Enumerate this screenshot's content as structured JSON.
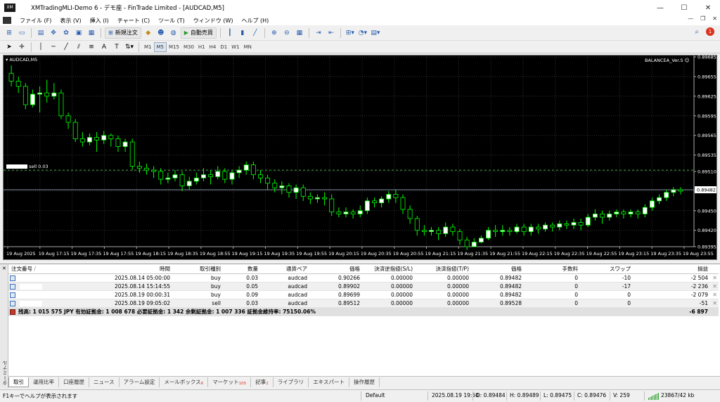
{
  "window": {
    "title": "XMTradingMLI-Demo 6 - デモ座 - FinTrade Limited - [AUDCAD,M5]",
    "app_logo": "XM",
    "minimize_glyph": "—",
    "maximize_glyph": "☐",
    "close_glyph": "✕"
  },
  "menu": {
    "items": [
      "ファイル (F)",
      "表示 (V)",
      "挿入 (I)",
      "チャート (C)",
      "ツール (T)",
      "ウィンドウ (W)",
      "ヘルプ (H)"
    ],
    "mdi_minimize": "—",
    "mdi_restore": "❐",
    "mdi_close": "✕"
  },
  "toolbar": {
    "new_order_label": "新規注文",
    "autotrade_label": "自動売買",
    "notification_count": "1",
    "timeframes": [
      "M1",
      "M5",
      "M15",
      "M30",
      "H1",
      "H4",
      "D1",
      "W1",
      "MN"
    ],
    "active_timeframe": "M5"
  },
  "chart": {
    "symbol_label": "AUDCAD,M5",
    "indicator_label": "BALANCEA_Ver.S",
    "order_line_label": "sell 0.03",
    "current_price": "0.89482",
    "colors": {
      "background": "#000000",
      "grid": "#303030",
      "bull_candle": "#ffffff",
      "bear_candle": "#000000",
      "wick": "#00ff00",
      "order_line": "#4aa84a",
      "bid_line": "#8090a0"
    }
  },
  "chart_data": {
    "type": "candlestick",
    "symbol": "AUDCAD",
    "timeframe": "M5",
    "y_ticks": [
      "0.89685",
      "0.89655",
      "0.89625",
      "0.89595",
      "0.89565",
      "0.89535",
      "0.89510",
      "0.89480",
      "0.89450",
      "0.89420",
      "0.89395"
    ],
    "ylim": [
      0.89395,
      0.89685
    ],
    "x_ticks": [
      "19 Aug 2025",
      "19 Aug 17:15",
      "19 Aug 17:35",
      "19 Aug 17:55",
      "19 Aug 18:15",
      "19 Aug 18:35",
      "19 Aug 18:55",
      "19 Aug 19:15",
      "19 Aug 19:35",
      "19 Aug 19:55",
      "19 Aug 20:15",
      "19 Aug 20:35",
      "19 Aug 20:55",
      "19 Aug 21:15",
      "19 Aug 21:35",
      "19 Aug 21:55",
      "19 Aug 22:15",
      "19 Aug 22:35",
      "19 Aug 22:55",
      "19 Aug 23:15",
      "19 Aug 23:35",
      "19 Aug 23:55"
    ],
    "order_level": 0.89512,
    "bid_level": 0.89482,
    "candles": [
      [
        0.8966,
        0.89648,
        0.89672,
        0.8964
      ],
      [
        0.89648,
        0.8964,
        0.89655,
        0.8963
      ],
      [
        0.8964,
        0.89612,
        0.89645,
        0.89605
      ],
      [
        0.89612,
        0.89628,
        0.89635,
        0.89608
      ],
      [
        0.89628,
        0.8963,
        0.8964,
        0.896
      ],
      [
        0.8963,
        0.89625,
        0.8965,
        0.89615
      ],
      [
        0.89625,
        0.8963,
        0.89645,
        0.8962
      ],
      [
        0.8963,
        0.89595,
        0.89635,
        0.8959
      ],
      [
        0.89595,
        0.89585,
        0.896,
        0.89575
      ],
      [
        0.89585,
        0.8956,
        0.8959,
        0.89555
      ],
      [
        0.8956,
        0.89555,
        0.8957,
        0.89548
      ],
      [
        0.89555,
        0.89562,
        0.89568,
        0.8955
      ],
      [
        0.89562,
        0.89558,
        0.8957,
        0.8954
      ],
      [
        0.89558,
        0.89565,
        0.89572,
        0.89552
      ],
      [
        0.89565,
        0.8956,
        0.89568,
        0.89548
      ],
      [
        0.8956,
        0.89548,
        0.89565,
        0.8954
      ],
      [
        0.89548,
        0.89555,
        0.8956,
        0.8954
      ],
      [
        0.89555,
        0.89518,
        0.8956,
        0.89512
      ],
      [
        0.89518,
        0.89515,
        0.89525,
        0.89508
      ],
      [
        0.89515,
        0.89512,
        0.89522,
        0.89505
      ],
      [
        0.89512,
        0.8951,
        0.89518,
        0.895
      ],
      [
        0.8951,
        0.89498,
        0.89515,
        0.8949
      ],
      [
        0.89498,
        0.895,
        0.89508,
        0.89492
      ],
      [
        0.895,
        0.89505,
        0.89512,
        0.89495
      ],
      [
        0.89505,
        0.89488,
        0.8951,
        0.8948
      ],
      [
        0.89488,
        0.89495,
        0.89502,
        0.89482
      ],
      [
        0.89495,
        0.895,
        0.89508,
        0.8949
      ],
      [
        0.895,
        0.89505,
        0.89515,
        0.89495
      ],
      [
        0.89505,
        0.89502,
        0.89512,
        0.8949
      ],
      [
        0.89502,
        0.8951,
        0.89518,
        0.89498
      ],
      [
        0.8951,
        0.89498,
        0.89515,
        0.89492
      ],
      [
        0.89498,
        0.89508,
        0.89512,
        0.8949
      ],
      [
        0.89508,
        0.89512,
        0.89518,
        0.895
      ],
      [
        0.89512,
        0.8952,
        0.89525,
        0.89505
      ],
      [
        0.8952,
        0.89505,
        0.89525,
        0.89498
      ],
      [
        0.89505,
        0.895,
        0.89512,
        0.89492
      ],
      [
        0.895,
        0.89492,
        0.89505,
        0.89482
      ],
      [
        0.89492,
        0.89485,
        0.89498,
        0.89478
      ],
      [
        0.89485,
        0.89488,
        0.89495,
        0.89475
      ],
      [
        0.89488,
        0.89478,
        0.89492,
        0.8947
      ],
      [
        0.89478,
        0.89485,
        0.8949,
        0.89468
      ],
      [
        0.89485,
        0.89472,
        0.8949,
        0.89465
      ],
      [
        0.89472,
        0.89468,
        0.89478,
        0.8946
      ],
      [
        0.89468,
        0.8947,
        0.89475,
        0.89462
      ],
      [
        0.8947,
        0.89468,
        0.89478,
        0.89458
      ],
      [
        0.89468,
        0.89448,
        0.89475,
        0.89442
      ],
      [
        0.89448,
        0.89445,
        0.89455,
        0.8944
      ],
      [
        0.89445,
        0.89448,
        0.89455,
        0.8944
      ],
      [
        0.89448,
        0.89445,
        0.89452,
        0.89438
      ],
      [
        0.89445,
        0.8945,
        0.89458,
        0.8944
      ],
      [
        0.8945,
        0.89465,
        0.8947,
        0.89445
      ],
      [
        0.89465,
        0.89462,
        0.8947,
        0.89455
      ],
      [
        0.89462,
        0.89468,
        0.89472,
        0.89455
      ],
      [
        0.89468,
        0.89475,
        0.8948,
        0.89462
      ],
      [
        0.89475,
        0.8947,
        0.89482,
        0.89462
      ],
      [
        0.8947,
        0.89452,
        0.89475,
        0.89445
      ],
      [
        0.89452,
        0.89438,
        0.89458,
        0.8943
      ],
      [
        0.89438,
        0.8942,
        0.89442,
        0.89412
      ],
      [
        0.8942,
        0.89418,
        0.89428,
        0.89412
      ],
      [
        0.89418,
        0.8942,
        0.89425,
        0.89412
      ],
      [
        0.8942,
        0.89415,
        0.89425,
        0.89405
      ],
      [
        0.89415,
        0.89425,
        0.89432,
        0.8941
      ],
      [
        0.89425,
        0.89418,
        0.8943,
        0.89412
      ],
      [
        0.89418,
        0.89405,
        0.89422,
        0.89398
      ],
      [
        0.89405,
        0.89395,
        0.8941,
        0.8939
      ],
      [
        0.89395,
        0.89402,
        0.89408,
        0.89395
      ],
      [
        0.89402,
        0.89408,
        0.89412,
        0.894
      ],
      [
        0.89408,
        0.8942,
        0.89425,
        0.89405
      ],
      [
        0.8942,
        0.89418,
        0.89428,
        0.8941
      ],
      [
        0.89418,
        0.8942,
        0.89428,
        0.89412
      ],
      [
        0.8942,
        0.89418,
        0.89425,
        0.89412
      ],
      [
        0.89418,
        0.89425,
        0.8943,
        0.89415
      ],
      [
        0.89425,
        0.89418,
        0.8943,
        0.89412
      ],
      [
        0.89418,
        0.89425,
        0.8943,
        0.89412
      ],
      [
        0.89425,
        0.89422,
        0.8943,
        0.89415
      ],
      [
        0.89422,
        0.89428,
        0.89432,
        0.89418
      ],
      [
        0.89428,
        0.89425,
        0.89432,
        0.89418
      ],
      [
        0.89425,
        0.8943,
        0.89435,
        0.8942
      ],
      [
        0.8943,
        0.89428,
        0.89435,
        0.89422
      ],
      [
        0.89428,
        0.89432,
        0.89438,
        0.89422
      ],
      [
        0.89432,
        0.89428,
        0.89438,
        0.8942
      ],
      [
        0.89428,
        0.8944,
        0.89445,
        0.89425
      ],
      [
        0.8944,
        0.89445,
        0.89452,
        0.89435
      ],
      [
        0.89445,
        0.8944,
        0.8945,
        0.8943
      ],
      [
        0.8944,
        0.89445,
        0.8945,
        0.89435
      ],
      [
        0.89445,
        0.89448,
        0.89452,
        0.8944
      ],
      [
        0.89448,
        0.89445,
        0.89452,
        0.89438
      ],
      [
        0.89445,
        0.89448,
        0.89452,
        0.8944
      ],
      [
        0.89448,
        0.89445,
        0.89452,
        0.89438
      ],
      [
        0.89445,
        0.89455,
        0.8946,
        0.8944
      ],
      [
        0.89455,
        0.89465,
        0.8947,
        0.8945
      ],
      [
        0.89465,
        0.8947,
        0.89475,
        0.8946
      ],
      [
        0.8947,
        0.89478,
        0.89482,
        0.89465
      ],
      [
        0.89478,
        0.89482,
        0.89486,
        0.89472
      ],
      [
        0.89482,
        0.8948,
        0.89486,
        0.89475
      ]
    ]
  },
  "terminal": {
    "side_label": "ターミナル",
    "close_glyph": "✕",
    "columns": [
      "注文番号",
      "時間",
      "取引種別",
      "数量",
      "通貨ペア",
      "価格",
      "決済逆指値(S/L)",
      "決済指値(T/P)",
      "価格",
      "手数料",
      "スワップ",
      "損益"
    ],
    "sort_glyph": "/",
    "rows": [
      {
        "time": "2025.08.14 05:00:00",
        "type": "buy",
        "volume": "0.03",
        "symbol": "audcad",
        "price": "0.90266",
        "sl": "0.00000",
        "tp": "0.00000",
        "cur_price": "0.89482",
        "commission": "0",
        "swap": "-10",
        "profit": "-2 504"
      },
      {
        "time": "2025.08.14 15:14:55",
        "type": "buy",
        "volume": "0.05",
        "symbol": "audcad",
        "price": "0.89902",
        "sl": "0.00000",
        "tp": "0.00000",
        "cur_price": "0.89482",
        "commission": "0",
        "swap": "-17",
        "profit": "-2 236"
      },
      {
        "time": "2025.08.19 00:00:31",
        "type": "buy",
        "volume": "0.09",
        "symbol": "audcad",
        "price": "0.89699",
        "sl": "0.00000",
        "tp": "0.00000",
        "cur_price": "0.89482",
        "commission": "0",
        "swap": "0",
        "profit": "-2 079"
      },
      {
        "time": "2025.08.19 09:05:02",
        "type": "sell",
        "volume": "0.03",
        "symbol": "audcad",
        "price": "0.89512",
        "sl": "0.00000",
        "tp": "0.00000",
        "cur_price": "0.89528",
        "commission": "0",
        "swap": "0",
        "profit": "-51"
      }
    ],
    "balance_line": "残高: 1 015 575 JPY  有効証拠金: 1 008 678  必要証拠金: 1 342  余剰証拠金: 1 007 336  証拠金維持率: 75150.06%",
    "total_profit": "-6 897",
    "tabs": [
      {
        "label": "取引",
        "badge": ""
      },
      {
        "label": "運用比率",
        "badge": ""
      },
      {
        "label": "口座履歴",
        "badge": ""
      },
      {
        "label": "ニュース",
        "badge": ""
      },
      {
        "label": "アラーム設定",
        "badge": ""
      },
      {
        "label": "メールボックス",
        "badge": "6"
      },
      {
        "label": "マーケット",
        "badge": "105"
      },
      {
        "label": "記事",
        "badge": "2"
      },
      {
        "label": "ライブラリ",
        "badge": ""
      },
      {
        "label": "エキスパート",
        "badge": ""
      },
      {
        "label": "操作履歴",
        "badge": ""
      }
    ]
  },
  "statusbar": {
    "help_text": "F1キーでヘルプが表示されます",
    "profile": "Default",
    "datetime": "2025.08.19 19:50",
    "open": "O: 0.89484",
    "high": "H: 0.89489",
    "low": "L: 0.89475",
    "close": "C: 0.89476",
    "volume": "V: 259",
    "traffic": "23867/42 kb"
  }
}
